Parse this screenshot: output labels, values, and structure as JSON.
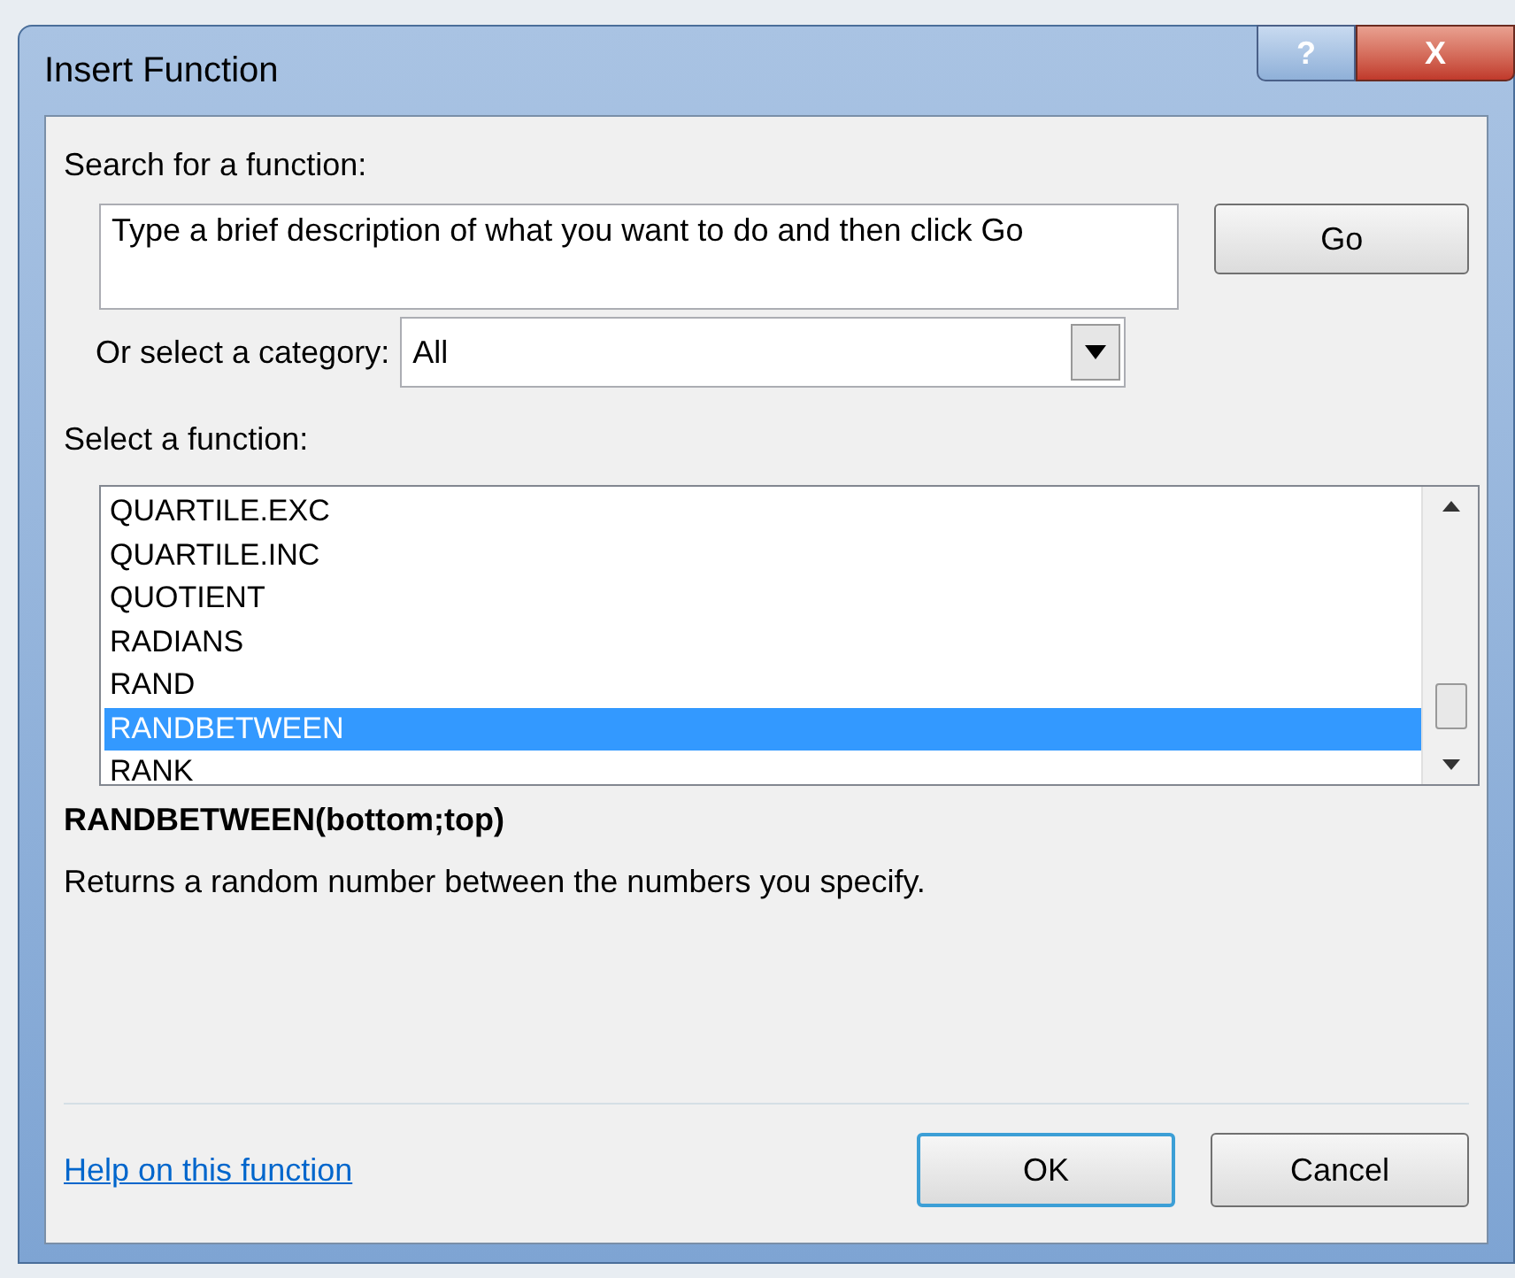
{
  "window": {
    "title": "Insert Function",
    "help_button": "?",
    "close_button": "X"
  },
  "search": {
    "label": "Search for a function:",
    "value": "Type a brief description of what you want to do and then click Go",
    "go_button": "Go"
  },
  "category": {
    "label": "Or select a category:",
    "value": "All"
  },
  "function_list": {
    "label": "Select a function:",
    "items": [
      {
        "name": "QUARTILE.EXC",
        "selected": false
      },
      {
        "name": "QUARTILE.INC",
        "selected": false
      },
      {
        "name": "QUOTIENT",
        "selected": false
      },
      {
        "name": "RADIANS",
        "selected": false
      },
      {
        "name": "RAND",
        "selected": false
      },
      {
        "name": "RANDBETWEEN",
        "selected": true
      },
      {
        "name": "RANK",
        "selected": false
      }
    ]
  },
  "signature": "RANDBETWEEN(bottom;top)",
  "description": "Returns a random number between the numbers you specify.",
  "help_link": "Help on this function",
  "buttons": [
    "OK",
    "Cancel"
  ]
}
